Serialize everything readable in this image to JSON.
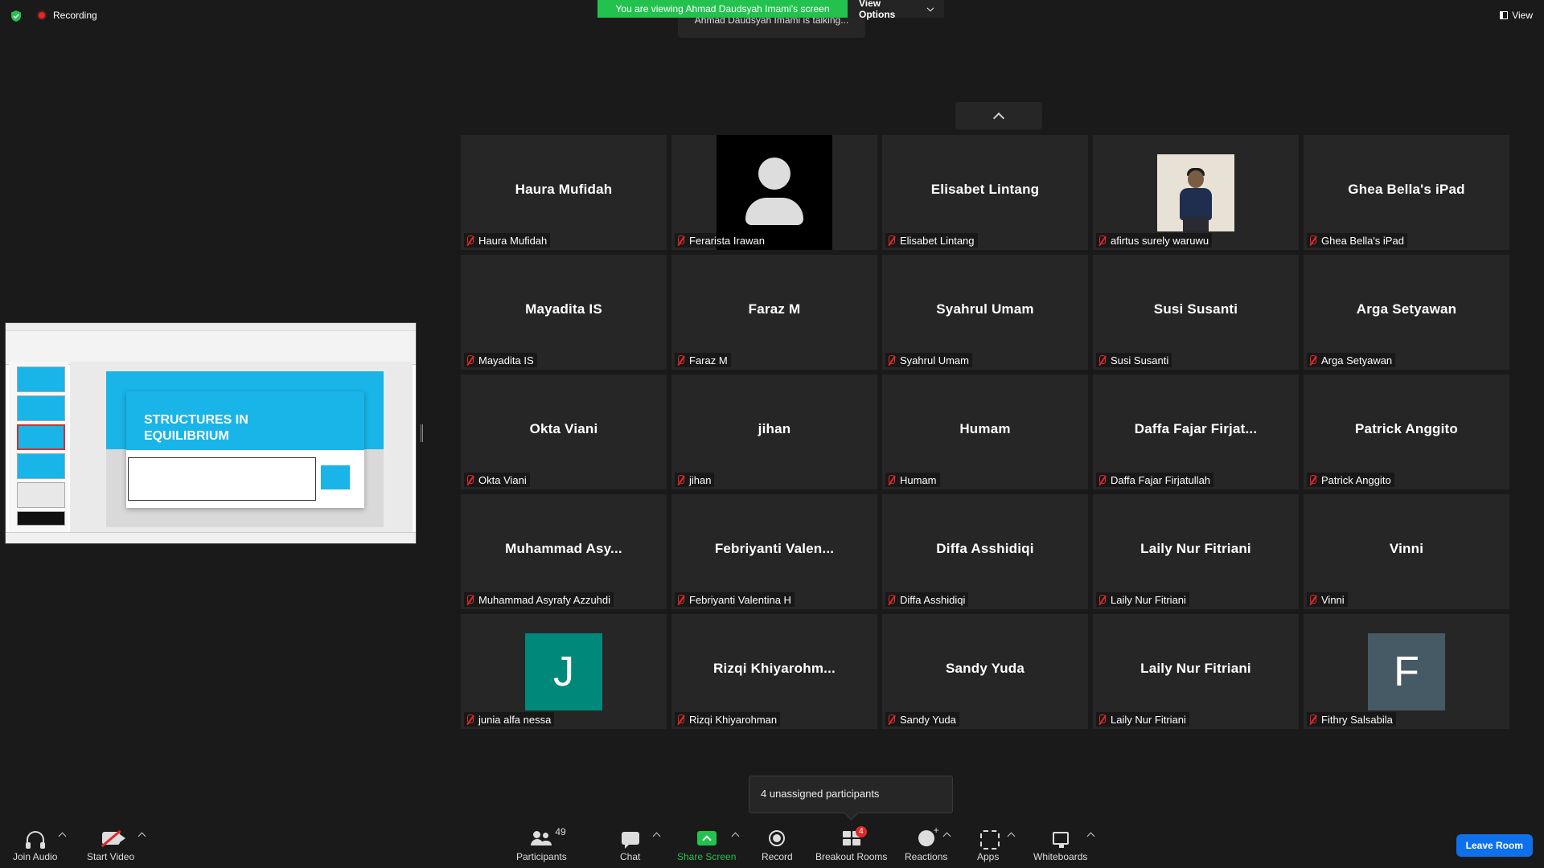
{
  "top": {
    "recording_label": "Recording",
    "viewing_banner": "You are viewing Ahmad Daudsyah Imami's screen",
    "view_options_label": "View Options",
    "talking_text": "Ahmad Daudsyah Imami is talking...",
    "view_label": "View",
    "shield_color": "#23c24f"
  },
  "shared_screen": {
    "slide_title_line1": "STRUCTURES IN",
    "slide_title_line2": "EQUILIBRIUM",
    "accent_color": "#19b4e8"
  },
  "tiles": [
    {
      "big": "Haura Mufidah",
      "label": "Haura Mufidah",
      "kind": "name"
    },
    {
      "big": "",
      "label": "Ferarista Irawan",
      "kind": "silhouette"
    },
    {
      "big": "Elisabet Lintang",
      "label": "Elisabet Lintang",
      "kind": "name"
    },
    {
      "big": "",
      "label": "afirtus surely waruwu",
      "kind": "photo"
    },
    {
      "big": "Ghea Bella's iPad",
      "label": "Ghea Bella's iPad",
      "kind": "name"
    },
    {
      "big": "Mayadita IS",
      "label": "Mayadita IS",
      "kind": "name"
    },
    {
      "big": "Faraz M",
      "label": "Faraz M",
      "kind": "name"
    },
    {
      "big": "Syahrul Umam",
      "label": "Syahrul Umam",
      "kind": "name"
    },
    {
      "big": "Susi Susanti",
      "label": "Susi Susanti",
      "kind": "name"
    },
    {
      "big": "Arga Setyawan",
      "label": "Arga Setyawan",
      "kind": "name"
    },
    {
      "big": "Okta Viani",
      "label": "Okta Viani",
      "kind": "name"
    },
    {
      "big": "jihan",
      "label": "jihan",
      "kind": "name"
    },
    {
      "big": "Humam",
      "label": "Humam",
      "kind": "name"
    },
    {
      "big": "Daffa Fajar Firjat...",
      "label": "Daffa Fajar Firjatullah",
      "kind": "name"
    },
    {
      "big": "Patrick Anggito",
      "label": "Patrick Anggito",
      "kind": "name"
    },
    {
      "big": "Muhammad Asy...",
      "label": "Muhammad Asyrafy Azzuhdi",
      "kind": "name"
    },
    {
      "big": "Febriyanti Valen...",
      "label": "Febriyanti Valentina H",
      "kind": "name"
    },
    {
      "big": "Diffa Asshidiqi",
      "label": "Diffa Asshidiqi",
      "kind": "name"
    },
    {
      "big": "Laily Nur Fitriani",
      "label": "Laily Nur Fitriani",
      "kind": "name"
    },
    {
      "big": "Vinni",
      "label": "Vinni",
      "kind": "name"
    },
    {
      "big": "J",
      "label": "junia alfa nessa",
      "kind": "initial",
      "color": "#00897b"
    },
    {
      "big": "Rizqi Khiyarohm...",
      "label": "Rizqi Khiyarohman",
      "kind": "name"
    },
    {
      "big": "Sandy Yuda",
      "label": "Sandy Yuda",
      "kind": "name"
    },
    {
      "big": "Laily Nur Fitriani",
      "label": "Laily Nur Fitriani",
      "kind": "name"
    },
    {
      "big": "F",
      "label": "Fithry Salsabila",
      "kind": "initial",
      "color": "#455a64"
    }
  ],
  "popup": {
    "text": "4 unassigned participants"
  },
  "toolbar": {
    "join_audio": "Join Audio",
    "start_video": "Start Video",
    "participants": "Participants",
    "participants_count": "49",
    "chat": "Chat",
    "share_screen": "Share Screen",
    "record": "Record",
    "breakout_rooms": "Breakout Rooms",
    "breakout_badge": "4",
    "reactions": "Reactions",
    "apps": "Apps",
    "whiteboards": "Whiteboards",
    "leave": "Leave Room"
  }
}
